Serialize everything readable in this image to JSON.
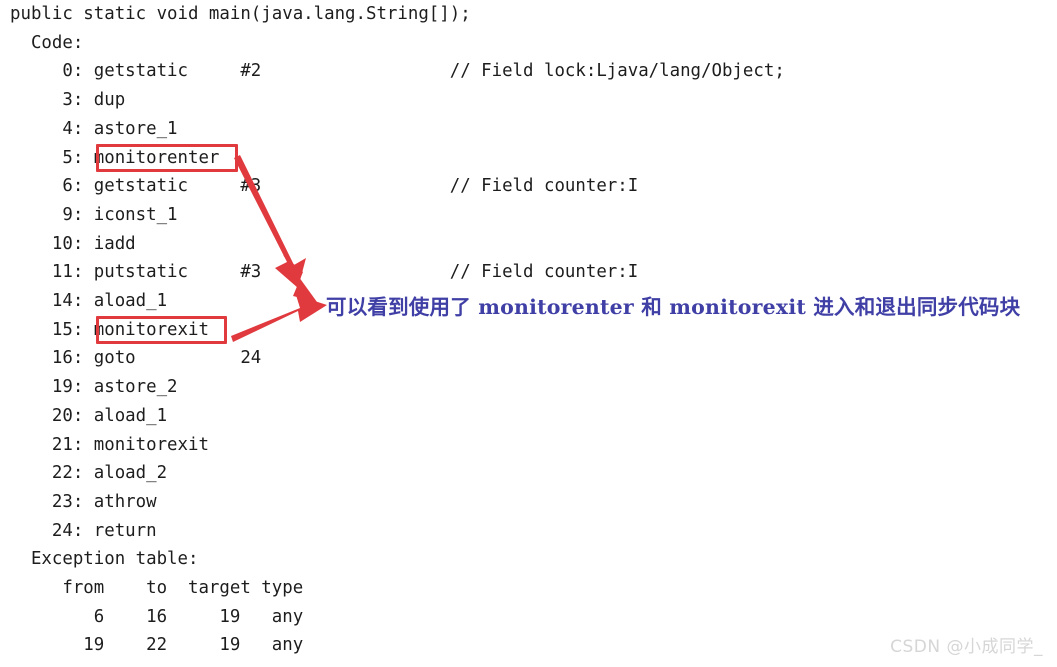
{
  "document": {
    "kind": "javap-bytecode-disassembly",
    "background_color": "#ffffff",
    "text_color": "#1d1d1d"
  },
  "code": {
    "lines": [
      {
        "text": "public static void main(java.lang.String[]);"
      },
      {
        "text": "  Code:"
      },
      {
        "text": "     0: getstatic     #2                  // Field lock:Ljava/lang/Object;"
      },
      {
        "text": "     3: dup"
      },
      {
        "text": "     4: astore_1"
      },
      {
        "text": "     5: monitorenter"
      },
      {
        "text": "     6: getstatic     #3                  // Field counter:I"
      },
      {
        "text": "     9: iconst_1"
      },
      {
        "text": "    10: iadd"
      },
      {
        "text": "    11: putstatic     #3                  // Field counter:I"
      },
      {
        "text": "    14: aload_1"
      },
      {
        "text": "    15: monitorexit"
      },
      {
        "text": "    16: goto          24"
      },
      {
        "text": "    19: astore_2"
      },
      {
        "text": "    20: aload_1"
      },
      {
        "text": "    21: monitorexit"
      },
      {
        "text": "    22: aload_2"
      },
      {
        "text": "    23: athrow"
      },
      {
        "text": "    24: return"
      },
      {
        "text": "  Exception table:"
      },
      {
        "text": "     from    to  target type"
      },
      {
        "text": "        6    16     19   any"
      },
      {
        "text": "       19    22     19   any"
      }
    ]
  },
  "highlights": {
    "color": "#e03a3f",
    "boxes": [
      {
        "id": "monitorenter",
        "label": "monitorenter"
      },
      {
        "id": "monitorexit",
        "label": "monitorexit"
      }
    ]
  },
  "arrows": {
    "color": "#e03a3f",
    "items": [
      {
        "id": "arrow-from-monitorenter",
        "from": "monitorenter-box",
        "to": "annotation-note"
      },
      {
        "id": "arrow-from-monitorexit",
        "from": "monitorexit-box",
        "to": "annotation-note"
      }
    ]
  },
  "annotation": {
    "color": "#3f3fa6",
    "text": "可以看到使用了 monitorenter 和 monitorexit 进入和退出同步代码块"
  },
  "watermark": {
    "text": "CSDN @小成同学_",
    "color": "#d6d6d6"
  }
}
